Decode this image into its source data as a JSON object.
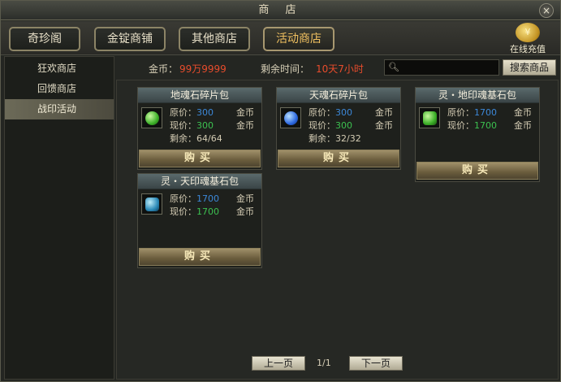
{
  "window": {
    "title": "商 店",
    "close_glyph": "×"
  },
  "tabs": [
    {
      "label": "奇珍阁",
      "active": false
    },
    {
      "label": "金锭商铺",
      "active": false
    },
    {
      "label": "其他商店",
      "active": false
    },
    {
      "label": "活动商店",
      "active": true
    }
  ],
  "recharge": {
    "label": "在线充值",
    "icon": "coin-stack-icon"
  },
  "sidebar": {
    "items": [
      {
        "label": "狂欢商店",
        "active": false
      },
      {
        "label": "回馈商店",
        "active": false
      },
      {
        "label": "战印活动",
        "active": true
      }
    ]
  },
  "info": {
    "gold_label": "金币：",
    "gold_value": "99万9999",
    "time_label": "剩余时间：",
    "time_value": "10天7小时",
    "search_placeholder": "",
    "search_button": "搜索商品"
  },
  "products": [
    {
      "name": "地魂石碎片包",
      "icon": "green-gem-icon",
      "orig_label": "原价：",
      "orig_price": "300",
      "cur_label": "现价：",
      "cur_price": "300",
      "currency": "金币",
      "remain_label": "剩余：",
      "remain": "64/64",
      "buy": "购买"
    },
    {
      "name": "天魂石碎片包",
      "icon": "blue-gem-icon",
      "orig_label": "原价：",
      "orig_price": "300",
      "cur_label": "现价：",
      "cur_price": "300",
      "currency": "金币",
      "remain_label": "剩余：",
      "remain": "32/32",
      "buy": "购买"
    },
    {
      "name": "灵・地印魂基石包",
      "icon": "green-stone-icon",
      "orig_label": "原价：",
      "orig_price": "1700",
      "cur_label": "现价：",
      "cur_price": "1700",
      "currency": "金币",
      "buy": "购买"
    },
    {
      "name": "灵・天印魂基石包",
      "icon": "blue-stone-icon",
      "orig_label": "原价：",
      "orig_price": "1700",
      "cur_label": "现价：",
      "cur_price": "1700",
      "currency": "金币",
      "buy": "购买"
    }
  ],
  "pager": {
    "prev": "上一页",
    "page": "1/1",
    "next": "下一页"
  },
  "colors": {
    "price_orig": "#3c88d8",
    "price_cur": "#3cc050",
    "highlight": "#e84c2c"
  }
}
